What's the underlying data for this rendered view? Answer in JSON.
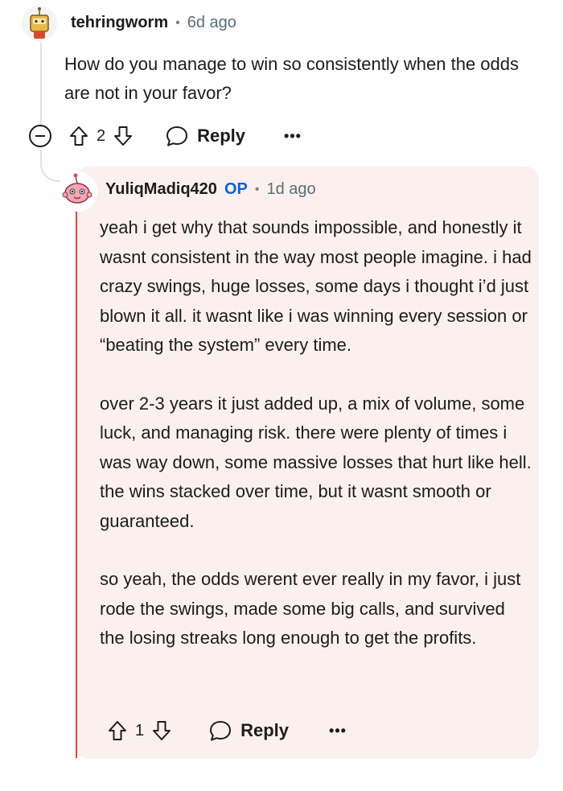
{
  "parent_comment": {
    "username": "tehringworm",
    "separator": "•",
    "time": "6d ago",
    "body": "How do you manage to win so consistently when the odds are not in your favor?",
    "vote_count": "2",
    "reply_label": "Reply",
    "more_label": "•••",
    "avatar_icon": "snoo-robot-avatar-icon"
  },
  "reply_comment": {
    "username": "YuliqMadiq420",
    "op_badge": "OP",
    "separator": "•",
    "time": "1d ago",
    "paragraphs": [
      "yeah i get why that sounds impossible, and honestly it wasnt consistent in the way most people imagine. i had crazy swings, huge losses, some days i thought i’d just blown it all. it wasnt like i was winning every session or “beating the system” every time.",
      "over 2-3 years it just added up, a mix of volume, some luck, and managing risk. there were plenty of times i was way down, some massive losses that hurt like hell. the wins stacked over time, but it wasnt smooth or guaranteed.",
      "so yeah, the odds werent ever really in my favor, i just rode the swings, made some big calls, and survived the losing streaks long enough to get the profits."
    ],
    "vote_count": "1",
    "reply_label": "Reply",
    "more_label": "•••",
    "avatar_icon": "snoo-pink-avatar-icon"
  },
  "colors": {
    "op_badge": "#0f60d6",
    "reply_background": "#fcf0ee",
    "highlight_line": "#e0453c"
  }
}
